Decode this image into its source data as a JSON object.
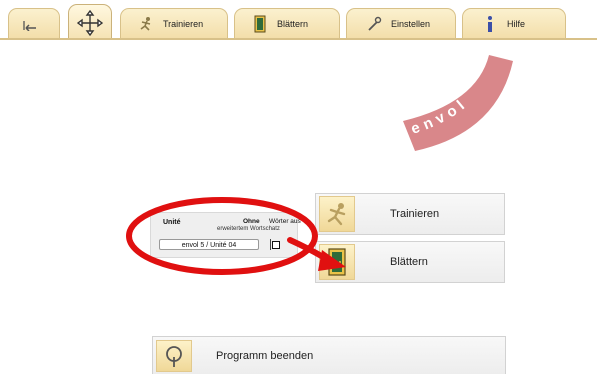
{
  "tabs": [
    {
      "name": "tab-back",
      "label": "",
      "icon": "back-arrow-icon"
    },
    {
      "name": "tab-navigate",
      "label": "",
      "icon": "move-arrows-icon",
      "active": true
    },
    {
      "name": "tab-trainieren",
      "label": "Trainieren",
      "icon": "runner-icon"
    },
    {
      "name": "tab-blaettern",
      "label": "Blättern",
      "icon": "door-icon"
    },
    {
      "name": "tab-einstellen",
      "label": "Einstellen",
      "icon": "tools-icon"
    },
    {
      "name": "tab-hilfe",
      "label": "Hilfe",
      "icon": "info-icon"
    }
  ],
  "logo": {
    "text": "envol",
    "color": "#d9878a"
  },
  "selector": {
    "col_unite": "Unité",
    "col_ohne": "Ohne",
    "col_woerter": "Wörter aus",
    "col_wortschatz": "erweitertem Wortschatz",
    "unit_value": "envol 5 / Unité 04",
    "checkbox_checked": false
  },
  "buttons": {
    "trainieren": {
      "label": "Trainieren",
      "icon": "runner-icon"
    },
    "blaettern": {
      "label": "Blättern",
      "icon": "door-icon"
    },
    "beenden": {
      "label": "Programm beenden",
      "icon": "power-icon"
    }
  },
  "annotation": {
    "color": "#e01010"
  }
}
